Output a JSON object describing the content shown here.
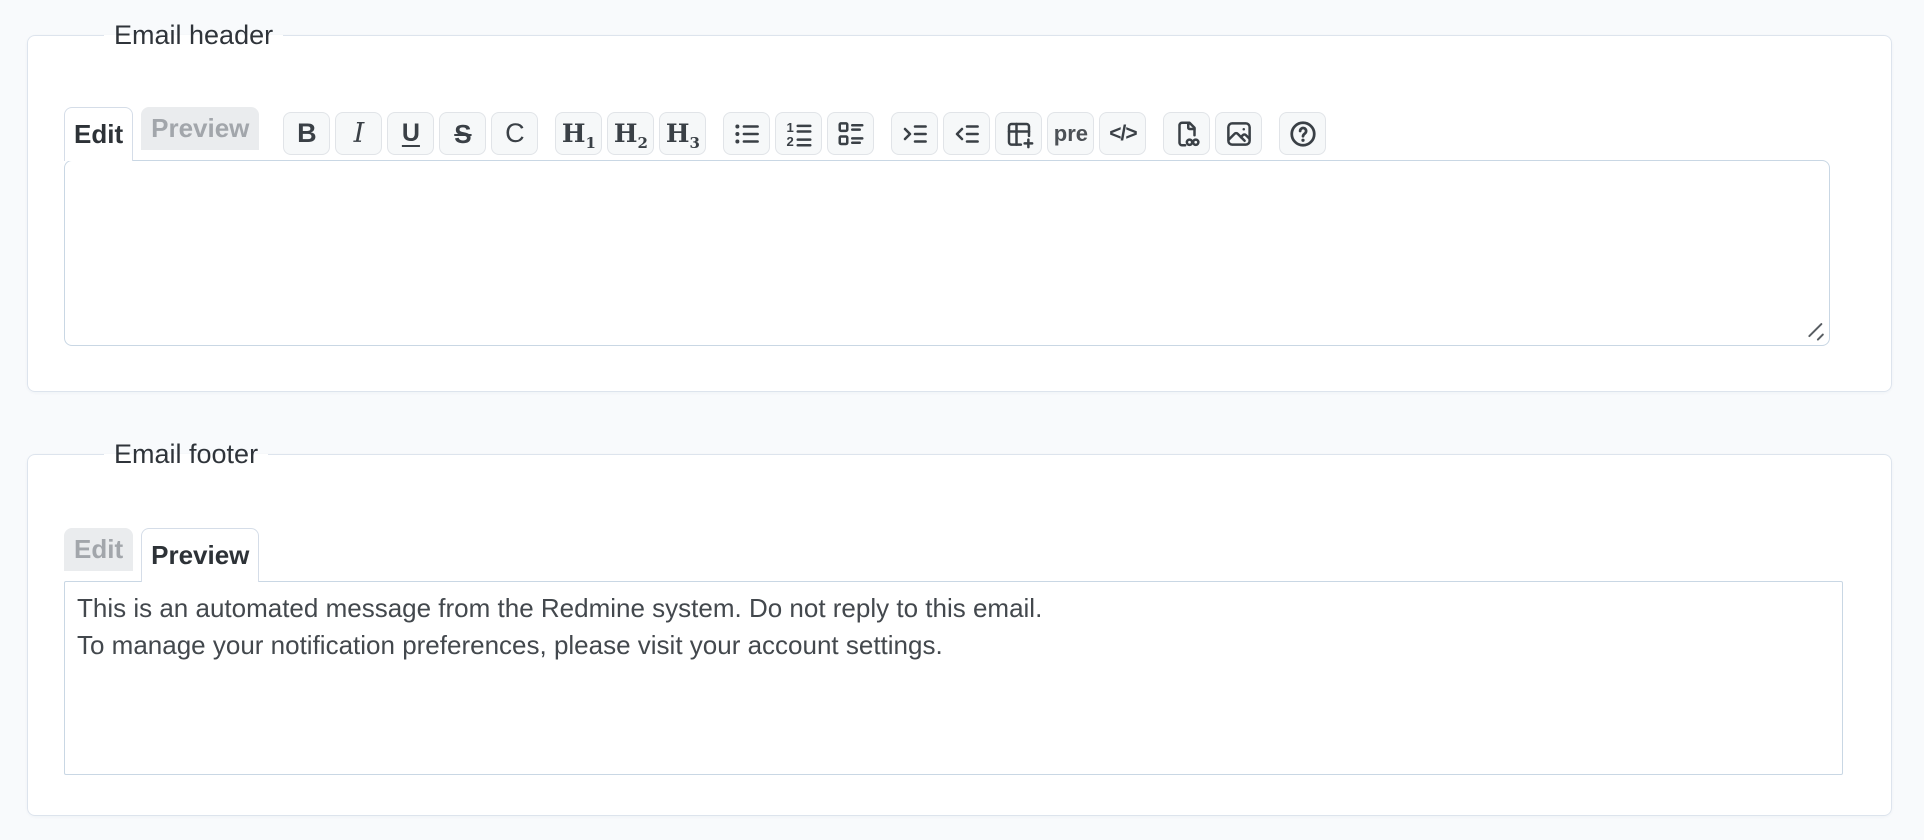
{
  "page": {
    "background": "#f8fafc"
  },
  "colors": {
    "fieldset_border": "#dde4ed",
    "input_border": "#c9d7e4",
    "button_bg": "#f6f8f9",
    "button_border": "#e1e4e8",
    "icon": "#3a4046",
    "tab_inactive_bg": "#eaecee",
    "tab_inactive_text": "#a2a6ab",
    "tab_active_text": "#2d3237",
    "body_text": "#43484d"
  },
  "email_header": {
    "legend": "Email header",
    "tabs": {
      "edit": "Edit",
      "preview": "Preview"
    },
    "active_tab": "Edit",
    "textarea_value": ""
  },
  "email_footer": {
    "legend": "Email footer",
    "tabs": {
      "edit": "Edit",
      "preview": "Preview"
    },
    "active_tab": "Preview",
    "preview_lines": [
      "This is an automated message from the Redmine system. Do not reply to this email.",
      "To manage your notification preferences, please visit your account settings."
    ]
  },
  "toolbar": {
    "groups": [
      [
        {
          "name": "bold",
          "glyph": "B"
        },
        {
          "name": "italic",
          "glyph": "I"
        },
        {
          "name": "underline",
          "glyph": "U"
        },
        {
          "name": "strikethrough",
          "glyph": "S"
        },
        {
          "name": "inline-code",
          "glyph": "C"
        }
      ],
      [
        {
          "name": "heading-1",
          "glyph": "H",
          "sub": "1"
        },
        {
          "name": "heading-2",
          "glyph": "H",
          "sub": "2"
        },
        {
          "name": "heading-3",
          "glyph": "H",
          "sub": "3"
        }
      ],
      [
        {
          "name": "unordered-list",
          "icon": "list-ul"
        },
        {
          "name": "ordered-list",
          "icon": "list-ol"
        },
        {
          "name": "task-list",
          "icon": "list-check"
        }
      ],
      [
        {
          "name": "blockquote",
          "icon": "indent"
        },
        {
          "name": "unquote",
          "icon": "outdent"
        },
        {
          "name": "insert-table",
          "icon": "table-plus"
        },
        {
          "name": "preformatted",
          "glyph": "pre"
        },
        {
          "name": "code-block",
          "glyph": "</>"
        }
      ],
      [
        {
          "name": "link-file",
          "icon": "file-link"
        },
        {
          "name": "insert-image",
          "icon": "photo"
        }
      ],
      [
        {
          "name": "help",
          "icon": "help"
        }
      ]
    ]
  }
}
